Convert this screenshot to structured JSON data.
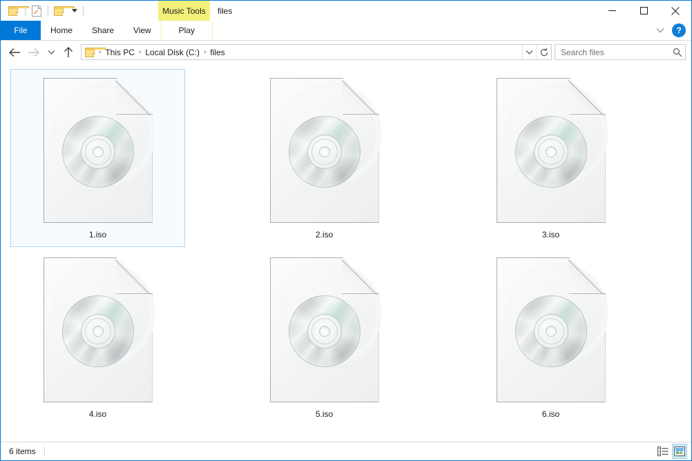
{
  "window": {
    "title": "files",
    "contextual_tab_header": "Music Tools",
    "minimize_label": "Minimize",
    "maximize_label": "Maximize",
    "close_label": "Close"
  },
  "quick_access": {
    "items": [
      {
        "name": "folder-icon",
        "label": "Properties"
      },
      {
        "name": "doc-check-icon",
        "label": "Properties"
      },
      {
        "name": "new-folder-icon",
        "label": "New folder"
      },
      {
        "name": "chevron-down-icon",
        "label": "Customize Quick Access Toolbar"
      }
    ]
  },
  "ribbon": {
    "tabs": [
      {
        "label": "File",
        "active": false
      },
      {
        "label": "Home",
        "active": false
      },
      {
        "label": "Share",
        "active": false
      },
      {
        "label": "View",
        "active": false
      },
      {
        "label": "Play",
        "active": false
      }
    ],
    "expand_label": "Expand the Ribbon",
    "help_label": "?"
  },
  "address": {
    "back_label": "Back",
    "forward_label": "Forward",
    "recent_label": "Recent locations",
    "up_label": "Up",
    "breadcrumbs": [
      {
        "label": "This PC"
      },
      {
        "label": "Local Disk (C:)"
      },
      {
        "label": "files"
      }
    ],
    "separator": "›",
    "dropdown_label": "Previous Locations",
    "refresh_label": "Refresh"
  },
  "search": {
    "placeholder": "Search files",
    "icon": "search-icon"
  },
  "files": [
    {
      "name": "1.iso",
      "selected": true
    },
    {
      "name": "2.iso",
      "selected": false
    },
    {
      "name": "3.iso",
      "selected": false
    },
    {
      "name": "4.iso",
      "selected": false
    },
    {
      "name": "5.iso",
      "selected": false
    },
    {
      "name": "6.iso",
      "selected": false
    }
  ],
  "status": {
    "item_count": "6 items",
    "details_view_label": "Details view",
    "large_icons_view_label": "Large icons view"
  },
  "colors": {
    "accent": "#0078d7",
    "contextual_tab": "#f4f07a",
    "selection_border": "#a8d8f0",
    "selection_fill": "#f7fbfe",
    "help_blue": "#0f7fd4"
  }
}
